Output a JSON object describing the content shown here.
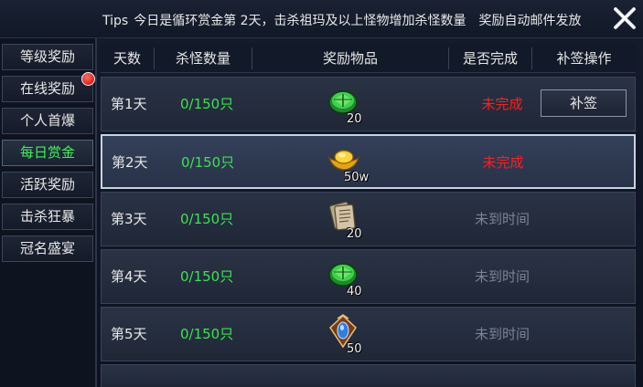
{
  "header": {
    "tips_label": "Tips",
    "tips_text": "今日是循环赏金第 2天，击杀祖玛及以上怪物增加杀怪数量　奖励自动邮件发放"
  },
  "sidebar": {
    "items": [
      {
        "label": "等级奖励",
        "active": false,
        "badge": false
      },
      {
        "label": "在线奖励",
        "active": false,
        "badge": true
      },
      {
        "label": "个人首爆",
        "active": false,
        "badge": false
      },
      {
        "label": "每日赏金",
        "active": true,
        "badge": false
      },
      {
        "label": "活跃奖励",
        "active": false,
        "badge": false
      },
      {
        "label": "击杀狂暴",
        "active": false,
        "badge": false
      },
      {
        "label": "冠名盛宴",
        "active": false,
        "badge": false
      }
    ]
  },
  "table": {
    "columns": [
      "天数",
      "杀怪数量",
      "奖励物品",
      "是否完成",
      "补签操作"
    ],
    "rows": [
      {
        "day": "第1天",
        "kills": "0/150只",
        "reward_icon": "green-gem-icon",
        "reward_qty": "20",
        "status": "未完成",
        "status_type": "incomplete",
        "action": "补签"
      },
      {
        "day": "第2天",
        "kills": "0/150只",
        "reward_icon": "gold-ingot-icon",
        "reward_qty": "50w",
        "status": "未完成",
        "status_type": "incomplete",
        "action": ""
      },
      {
        "day": "第3天",
        "kills": "0/150只",
        "reward_icon": "scroll-bundle-icon",
        "reward_qty": "20",
        "status": "未到时间",
        "status_type": "notime",
        "action": ""
      },
      {
        "day": "第4天",
        "kills": "0/150只",
        "reward_icon": "green-gem-icon",
        "reward_qty": "40",
        "status": "未到时间",
        "status_type": "notime",
        "action": ""
      },
      {
        "day": "第5天",
        "kills": "0/150只",
        "reward_icon": "blue-amulet-icon",
        "reward_qty": "50",
        "status": "未到时间",
        "status_type": "notime",
        "action": ""
      }
    ]
  },
  "colors": {
    "active_green": "#3df25a",
    "kill_green": "#3be34f",
    "incomplete_red": "#ff1e1e",
    "notime_gray": "#7b8394"
  }
}
